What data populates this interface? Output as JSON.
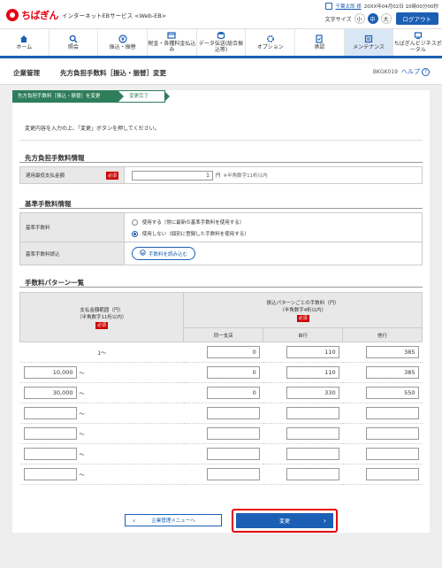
{
  "header": {
    "logo_text": "ちばぎん",
    "service_name": "インターネットEBサービス <Web-EB>",
    "user_name": "千葉太郎 様",
    "last_login": "20XX年04月02日 10時00分00秒",
    "font_size_label": "文字サイズ",
    "font_sizes": [
      "小",
      "中",
      "大"
    ],
    "font_size_selected": "中",
    "logout": "ログアウト"
  },
  "nav": [
    {
      "label": "ホーム",
      "icon": "home-icon"
    },
    {
      "label": "照会",
      "icon": "search-icon"
    },
    {
      "label": "振込・振替",
      "icon": "yen-icon"
    },
    {
      "label": "税金・各種料金払込み",
      "icon": "tax-icon"
    },
    {
      "label": "データ伝送(総合振込等)",
      "icon": "database-icon"
    },
    {
      "label": "オプション",
      "icon": "option-icon"
    },
    {
      "label": "承認",
      "icon": "approve-icon"
    },
    {
      "label": "メンテナンス",
      "icon": "maintenance-icon",
      "active": true
    },
    {
      "label": "ちばぎんビジネスポータル",
      "icon": "portal-icon"
    }
  ],
  "page": {
    "category": "企業管理",
    "title": "先方負担手数料［振込・振替］変更",
    "screen_id": "BKGK019",
    "help": "ヘルプ"
  },
  "steps": [
    "先方負担手数料［振込・振替］を変更",
    "変更完了"
  ],
  "instruction": "変更内容を入力の上、「変更」ボタンを押してください。",
  "info_section": {
    "title": "先方負担手数料情報",
    "label": "適用最低支払金額",
    "required": "必須",
    "value": "1",
    "unit": "円",
    "note": "※半角数字11桁以内"
  },
  "base_section": {
    "title": "基準手数料情報",
    "fee_label": "基準手数料",
    "options": [
      {
        "label": "使用する（常に最新の基準手数料を使用する）",
        "checked": false
      },
      {
        "label": "使用しない（個別に登録した手数料を使用する）",
        "checked": true
      }
    ],
    "load_label": "基準手数料読込",
    "load_button": "手数料を読み込む"
  },
  "pattern_section": {
    "title": "手数料パターン一覧",
    "col_range": "支払金額範囲（円）",
    "col_range_note": "（半角数字11桁以内）",
    "col_fee": "振込パターンごとの手数料（円）",
    "col_fee_note": "（半角数字4桁以内）",
    "required": "必須",
    "sub_cols": [
      "同一支店",
      "自行",
      "他行"
    ],
    "rows": [
      {
        "from": "1",
        "same": "0",
        "own": "110",
        "other": "385",
        "editable_from": false
      },
      {
        "from": "10,000",
        "same": "0",
        "own": "110",
        "other": "385",
        "editable_from": true
      },
      {
        "from": "30,000",
        "same": "0",
        "own": "330",
        "other": "550",
        "editable_from": true
      },
      {
        "from": "",
        "same": "",
        "own": "",
        "other": "",
        "editable_from": true
      },
      {
        "from": "",
        "same": "",
        "own": "",
        "other": "",
        "editable_from": true
      },
      {
        "from": "",
        "same": "",
        "own": "",
        "other": "",
        "editable_from": true
      },
      {
        "from": "",
        "same": "",
        "own": "",
        "other": "",
        "editable_from": true
      }
    ],
    "tilde": "～"
  },
  "buttons": {
    "back": "企業管理メニューへ",
    "change": "変更"
  }
}
